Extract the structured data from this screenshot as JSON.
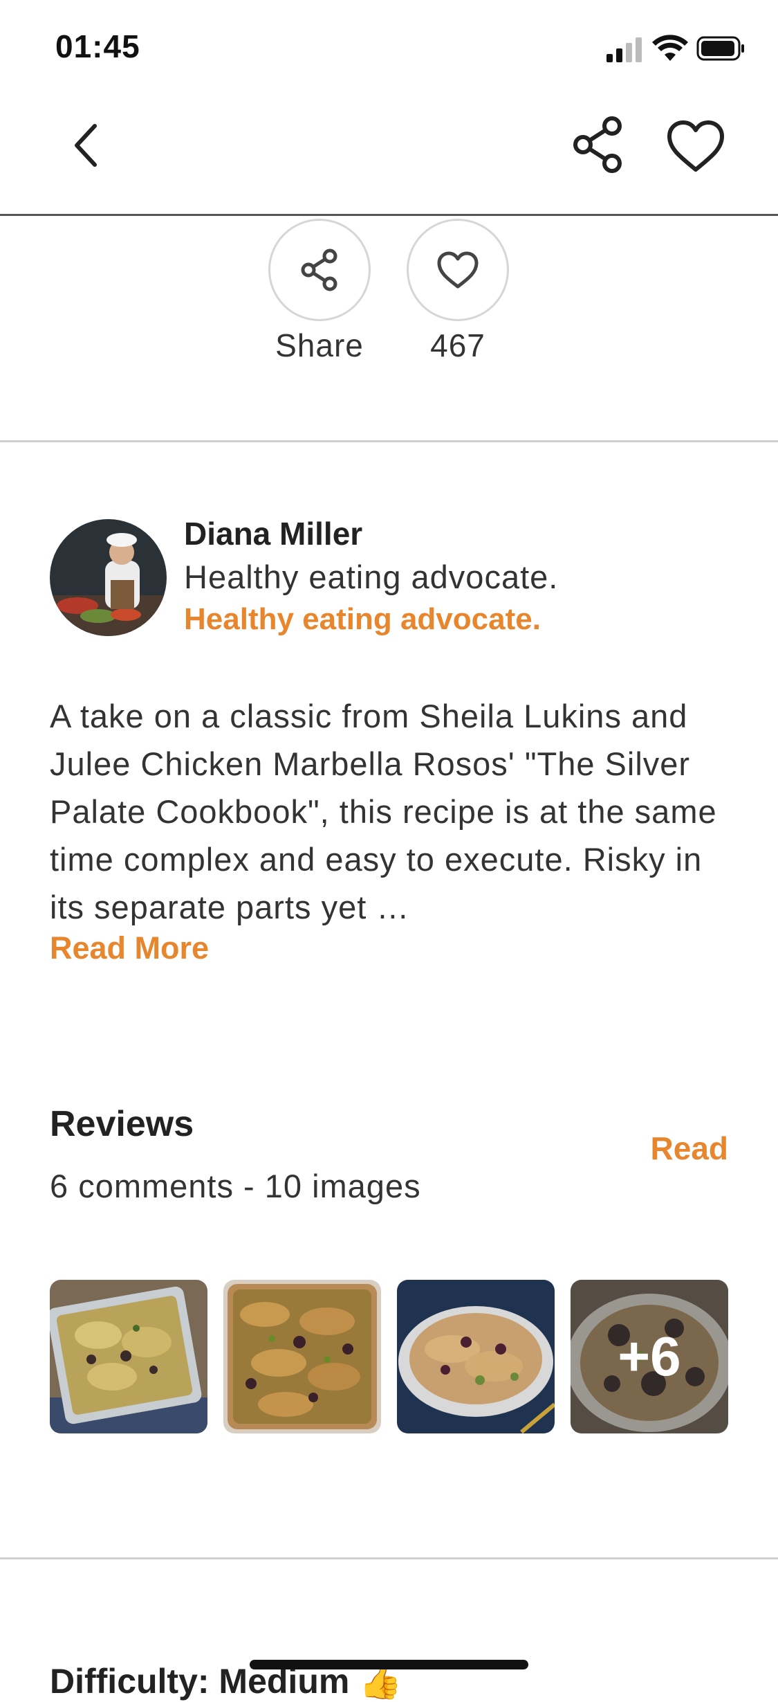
{
  "status_bar": {
    "time": "01:45",
    "icons": [
      "signal-icon",
      "wifi-icon",
      "battery-icon"
    ]
  },
  "nav": {
    "back_icon": "chevron-left-icon",
    "share_icon": "share-icon",
    "favorite_icon": "heart-icon"
  },
  "actions": {
    "share_label": "Share",
    "like_count": "467"
  },
  "author": {
    "name": "Diana Miller",
    "bio": "Healthy eating advocate.",
    "bio_highlight": "Healthy eating advocate."
  },
  "description": {
    "text": "A take on a classic from Sheila Lukins and Julee Chicken Marbella Rosos' \"The Silver Palate Cookbook\", this recipe is at the same time complex and easy to execute. Risky in its separate parts yet …",
    "read_more": "Read More"
  },
  "reviews": {
    "title": "Reviews",
    "summary": "6 comments - 10 images",
    "read_label": "Read",
    "more_count": "+6"
  },
  "next_section": {
    "title": "Difficulty: Medium 👍"
  },
  "colors": {
    "accent": "#e8862e",
    "text": "#222222",
    "divider": "#cfcfcf"
  }
}
